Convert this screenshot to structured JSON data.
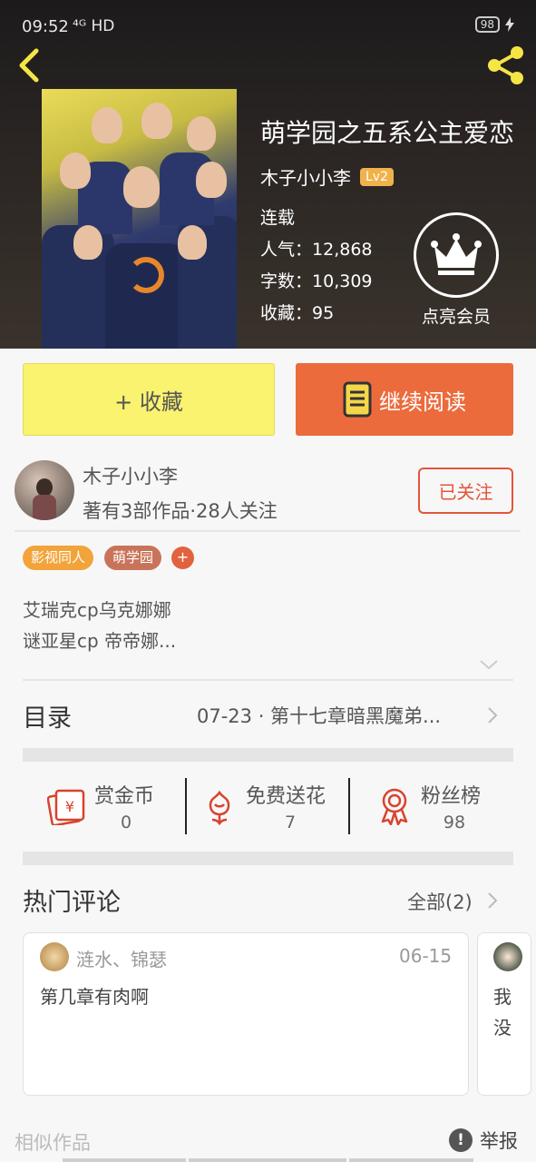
{
  "status_bar": {
    "time": "09:52",
    "network": "⁴ᴳ HD",
    "battery": "98"
  },
  "book": {
    "title": "萌学园之五系公主爱恋",
    "author": "木子小小李",
    "level": "Lv2",
    "status": "连载",
    "popularity_label": "人气：",
    "popularity": "12,868",
    "words_label": "字数：",
    "words": "10,309",
    "favorites_label": "收藏：",
    "favorites": "95",
    "vip_label": "点亮会员"
  },
  "actions": {
    "favorite": "+ 收藏",
    "continue_reading": "继续阅读"
  },
  "author_card": {
    "name": "木子小小李",
    "stats": "著有3部作品·28人关注",
    "follow_button": "已关注"
  },
  "tags": [
    {
      "label": "影视同人",
      "color": "#f2a43a"
    },
    {
      "label": "萌学园",
      "color": "#c9745a"
    }
  ],
  "tag_add": "+",
  "description": [
    "艾瑞克cp乌克娜娜",
    "谜亚星cp 帝帝娜..."
  ],
  "toc": {
    "label": "目录",
    "latest": "07-23 · 第十七章暗黑魔弟..."
  },
  "stats": [
    {
      "label": "赏金币",
      "value": "0",
      "icon": "red-envelope-icon"
    },
    {
      "label": "免费送花",
      "value": "7",
      "icon": "flower-icon"
    },
    {
      "label": "粉丝榜",
      "value": "98",
      "icon": "medal-icon"
    }
  ],
  "comments": {
    "title": "热门评论",
    "all_label": "全部(2)",
    "items": [
      {
        "user": "涟水、锦瑟",
        "date": "06-15",
        "text": "第几章有肉啊"
      },
      {
        "text_line1": "我",
        "text_line2": "没"
      }
    ]
  },
  "footer": {
    "similar": "相似作品",
    "report": "举报",
    "report_icon": "!"
  },
  "colors": {
    "accent": "#ec6b3c",
    "favorite_bg": "#f9f36f",
    "follow": "#e4553b",
    "lv_badge": "#f0b24a"
  }
}
